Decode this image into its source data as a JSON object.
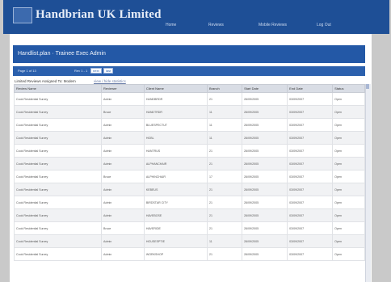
{
  "header": {
    "brand": "Handbrian UK Limited",
    "nav": [
      "Home",
      "Reviews",
      "Mobile Reviews",
      "Log Out"
    ]
  },
  "page": {
    "title": "Handlist.plan · Trainee Exec Admin"
  },
  "pager": {
    "page_label": "Page 1 of 13",
    "range_label": "Rev 1 - 1",
    "next": "next",
    "last": "last"
  },
  "note": {
    "text": "Limited Reviews Assigned To: Modem",
    "link": "view / hide statistics"
  },
  "table": {
    "headers": [
      "Review Name",
      "Reviewer",
      "Client Name",
      "Branch",
      "Start Date",
      "End Date",
      "Status"
    ],
    "rows": [
      [
        "Cook Residential Survey",
        "Admin",
        "HANDBRDR",
        "21",
        "26/09/2005",
        "03/09/2007",
        "Open"
      ],
      [
        "Cook Residential Survey",
        "Bruce",
        "HANDTRDR",
        "11",
        "26/09/2005",
        "03/09/2007",
        "Open"
      ],
      [
        "Cook Residential Survey",
        "Admin",
        "BLUESPECTUT",
        "11",
        "26/09/2005",
        "03/09/2007",
        "Open"
      ],
      [
        "Cook Residential Survey",
        "Admin",
        "HOBL",
        "11",
        "26/09/2005",
        "03/09/2007",
        "Open"
      ],
      [
        "Cook Residential Survey",
        "Admin",
        "HANTRUS",
        "21",
        "26/09/2005",
        "03/09/2007",
        "Open"
      ],
      [
        "Cook Residential Survey",
        "Admin",
        "ALPHANCHAIR",
        "21",
        "26/09/2005",
        "03/09/2007",
        "Open"
      ],
      [
        "Cook Residential Survey",
        "Bruce",
        "ALPHINCHAIR",
        "17",
        "26/09/2005",
        "03/09/2007",
        "Open"
      ],
      [
        "Cook Residential Survey",
        "Admin",
        "KEBEUS",
        "21",
        "26/09/2005",
        "03/09/2007",
        "Open"
      ],
      [
        "Cook Residential Survey",
        "Admin",
        "BIRDSTAR CITY",
        "21",
        "26/09/2005",
        "03/09/2007",
        "Open"
      ],
      [
        "Cook Residential Survey",
        "Admin",
        "HAVEBOSE",
        "21",
        "26/09/2005",
        "03/09/2007",
        "Open"
      ],
      [
        "Cook Residential Survey",
        "Bruce",
        "HAVERIDE",
        "21",
        "26/09/2005",
        "03/09/2007",
        "Open"
      ],
      [
        "Cook Residential Survey",
        "Admin",
        "HOUSESPTIE",
        "11",
        "26/09/2005",
        "03/09/2007",
        "Open"
      ],
      [
        "Cook Residential Survey",
        "Admin",
        "WORKSHOP",
        "21",
        "26/09/2005",
        "03/09/2007",
        "Open"
      ]
    ]
  }
}
